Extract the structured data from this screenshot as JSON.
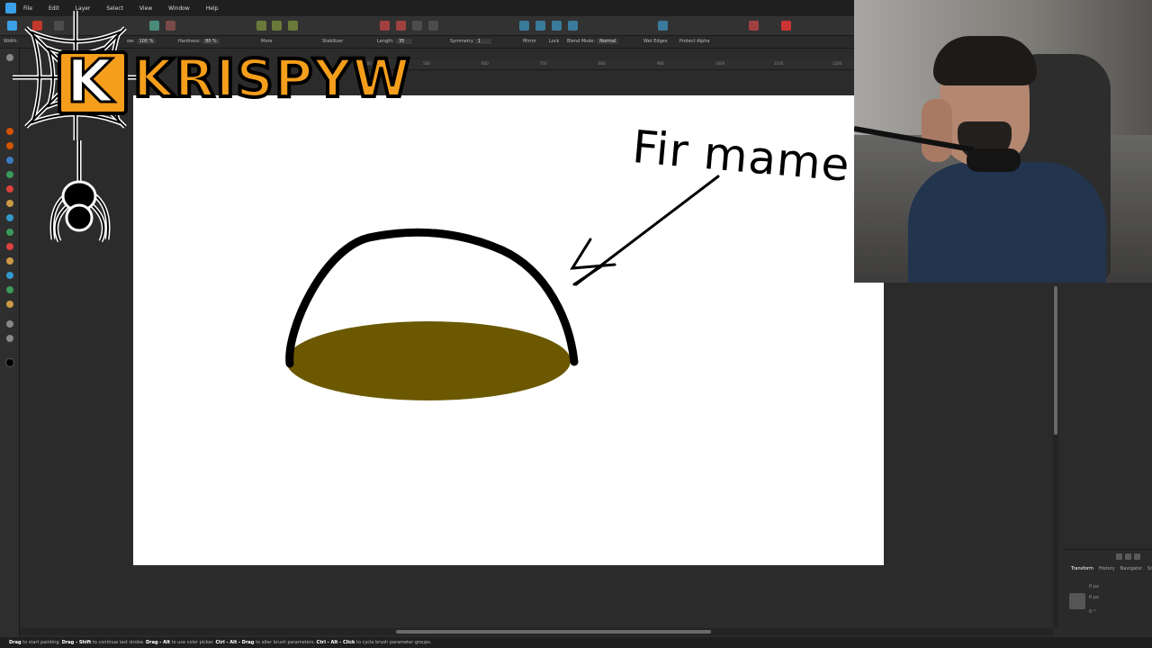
{
  "menu": {
    "items": [
      "File",
      "Edit",
      "Layer",
      "Select",
      "View",
      "Window",
      "Help"
    ]
  },
  "context_toolbar": {
    "width_label": "Width:",
    "opacity_label": "ow:",
    "opacity_value": "100 %",
    "hardness_label": "Hardness:",
    "hardness_value": "80 %",
    "more_label": "More",
    "stabilizer_label": "Stabilizer",
    "length_label": "Length:",
    "length_value": "35",
    "symmetry_label": "Symmetry",
    "symmetry_value": "1",
    "mirror_label": "Mirror",
    "lock_label": "Lock",
    "blend_mode_label": "Blend Mode:",
    "blend_mode_value": "Normal",
    "wet_edges_label": "Wet Edges",
    "protect_alpha_label": "Protect Alpha"
  },
  "ruler": {
    "ticks": [
      "400",
      "500",
      "600",
      "700",
      "800",
      "900",
      "1000",
      "1100",
      "1200"
    ]
  },
  "canvas": {
    "handwritten_text": "Fir mame",
    "fill_color": "#6b5800",
    "stroke_color": "#000000"
  },
  "logo": {
    "k_letter": "K",
    "brand_text": "KRISPYW",
    "brand_color": "#f59e1b"
  },
  "right_panel": {
    "tabs": [
      "Transform",
      "History",
      "Navigator",
      "Sn"
    ],
    "rows": [
      "0 px",
      "0 px",
      "0 °"
    ]
  },
  "statusbar": {
    "parts": [
      {
        "bold": "Drag",
        "text": " to start painting. "
      },
      {
        "bold": "Drag - Shift",
        "text": " to continue last stroke. "
      },
      {
        "bold": "Drag - Alt",
        "text": " to use color picker. "
      },
      {
        "bold": "Ctrl - Alt - Drag",
        "text": " to alter brush parameters. "
      },
      {
        "bold": "Ctrl - Alt - Click",
        "text": " to cycle brush parameter groups."
      }
    ]
  },
  "colors": {
    "app_bg": "#2b2b2b",
    "accent": "#3aa0e8",
    "tool_red": "#e04040"
  }
}
